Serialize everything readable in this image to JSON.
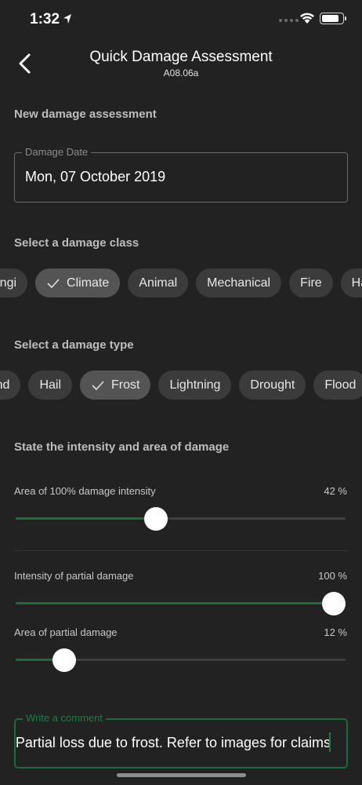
{
  "status_bar": {
    "time": "1:32"
  },
  "header": {
    "title": "Quick Damage Assessment",
    "subtitle": "A08.06a"
  },
  "form": {
    "heading": "New damage assessment",
    "date_field": {
      "label": "Damage Date",
      "value": "Mon, 07 October 2019"
    },
    "damage_class": {
      "heading": "Select a damage class",
      "chips": [
        {
          "label": "Fungi",
          "selected": false
        },
        {
          "label": "Climate",
          "selected": true
        },
        {
          "label": "Animal",
          "selected": false
        },
        {
          "label": "Mechanical",
          "selected": false
        },
        {
          "label": "Fire",
          "selected": false
        },
        {
          "label": "Hail",
          "selected": false
        }
      ]
    },
    "damage_type": {
      "heading": "Select a damage type",
      "chips": [
        {
          "label": "Wind",
          "selected": false
        },
        {
          "label": "Hail",
          "selected": false
        },
        {
          "label": "Frost",
          "selected": true
        },
        {
          "label": "Lightning",
          "selected": false
        },
        {
          "label": "Drought",
          "selected": false
        },
        {
          "label": "Flood",
          "selected": false
        }
      ]
    },
    "intensity": {
      "heading": "State the intensity and area of damage",
      "sliders": [
        {
          "label": "Area of 100% damage intensity",
          "value_text": "42 %",
          "value": 42
        },
        {
          "label": "Intensity of partial damage",
          "value_text": "100 %",
          "value": 100
        },
        {
          "label": "Area of partial damage",
          "value_text": "12 %",
          "value": 12
        }
      ]
    },
    "comment": {
      "label": "Write a comment",
      "value": "Partial loss due to frost.  Refer to images for claims"
    }
  },
  "colors": {
    "background": "#222222",
    "accent_green": "#1f6b3a",
    "chip": "#3b3b3b",
    "chip_selected": "#545454"
  },
  "icons": [
    "location-arrow-icon",
    "cellular-signal-icon",
    "wifi-icon",
    "battery-icon",
    "back-chevron-icon",
    "check-icon"
  ]
}
